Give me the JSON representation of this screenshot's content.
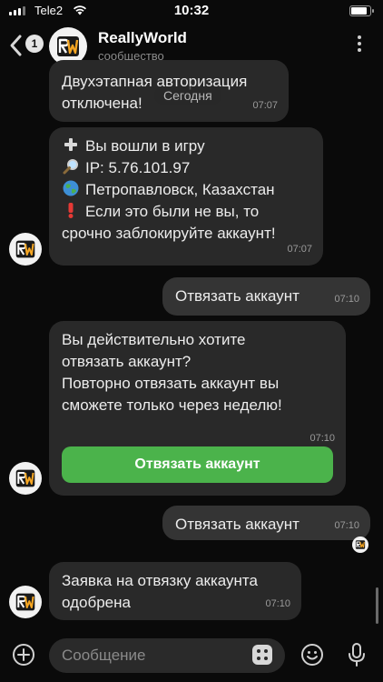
{
  "status_bar": {
    "carrier": "Tele2",
    "time": "10:32",
    "battery_level": 0.9
  },
  "header": {
    "back_badge": "1",
    "title": "ReallyWorld",
    "subtitle": "сообщество",
    "avatar_icon": "reallyworld-logo",
    "menu_icon": "more-vertical-icon"
  },
  "date_chip": "Сегодня",
  "messages": [
    {
      "direction": "incoming",
      "lines": [
        "Двухэтапная авторизация",
        "отключена!"
      ],
      "time": "07:07"
    },
    {
      "direction": "incoming",
      "lines": [
        "Вы вошли в игру",
        "IP: 5.76.101.97",
        "Петропавловск, Казахстан",
        "Если это были не вы, то",
        "срочно заблокируйте аккаунт!"
      ],
      "line_icons": [
        "plus-emoji",
        "magnifier-emoji",
        "globe-emoji",
        "exclamation-emoji",
        ""
      ],
      "time": "07:07"
    },
    {
      "direction": "outgoing",
      "lines": [
        "Отвязать аккаунт"
      ],
      "time": "07:10"
    },
    {
      "direction": "incoming",
      "lines": [
        "Вы действительно хотите",
        "отвязать аккаунт?",
        "Повторно отвязать аккаунт вы",
        "сможете только через неделю!"
      ],
      "time": "07:10",
      "button": "Отвязать аккаунт"
    },
    {
      "direction": "outgoing",
      "lines": [
        "Отвязать аккаунт"
      ],
      "time": "07:10"
    },
    {
      "direction": "incoming",
      "lines": [
        "Заявка на отвязку аккаунта",
        "одобрена"
      ],
      "time": "07:10"
    }
  ],
  "composer": {
    "placeholder": "Сообщение",
    "icons": [
      "plus-circle-icon",
      "keyboard-bot-icon",
      "smile-icon",
      "microphone-icon"
    ]
  },
  "colors": {
    "background": "#0a0a0a",
    "incoming_bubble": "#292929",
    "outgoing_bubble": "#343434",
    "button_green": "#4bb34b",
    "logo_orange": "#f5a623"
  }
}
